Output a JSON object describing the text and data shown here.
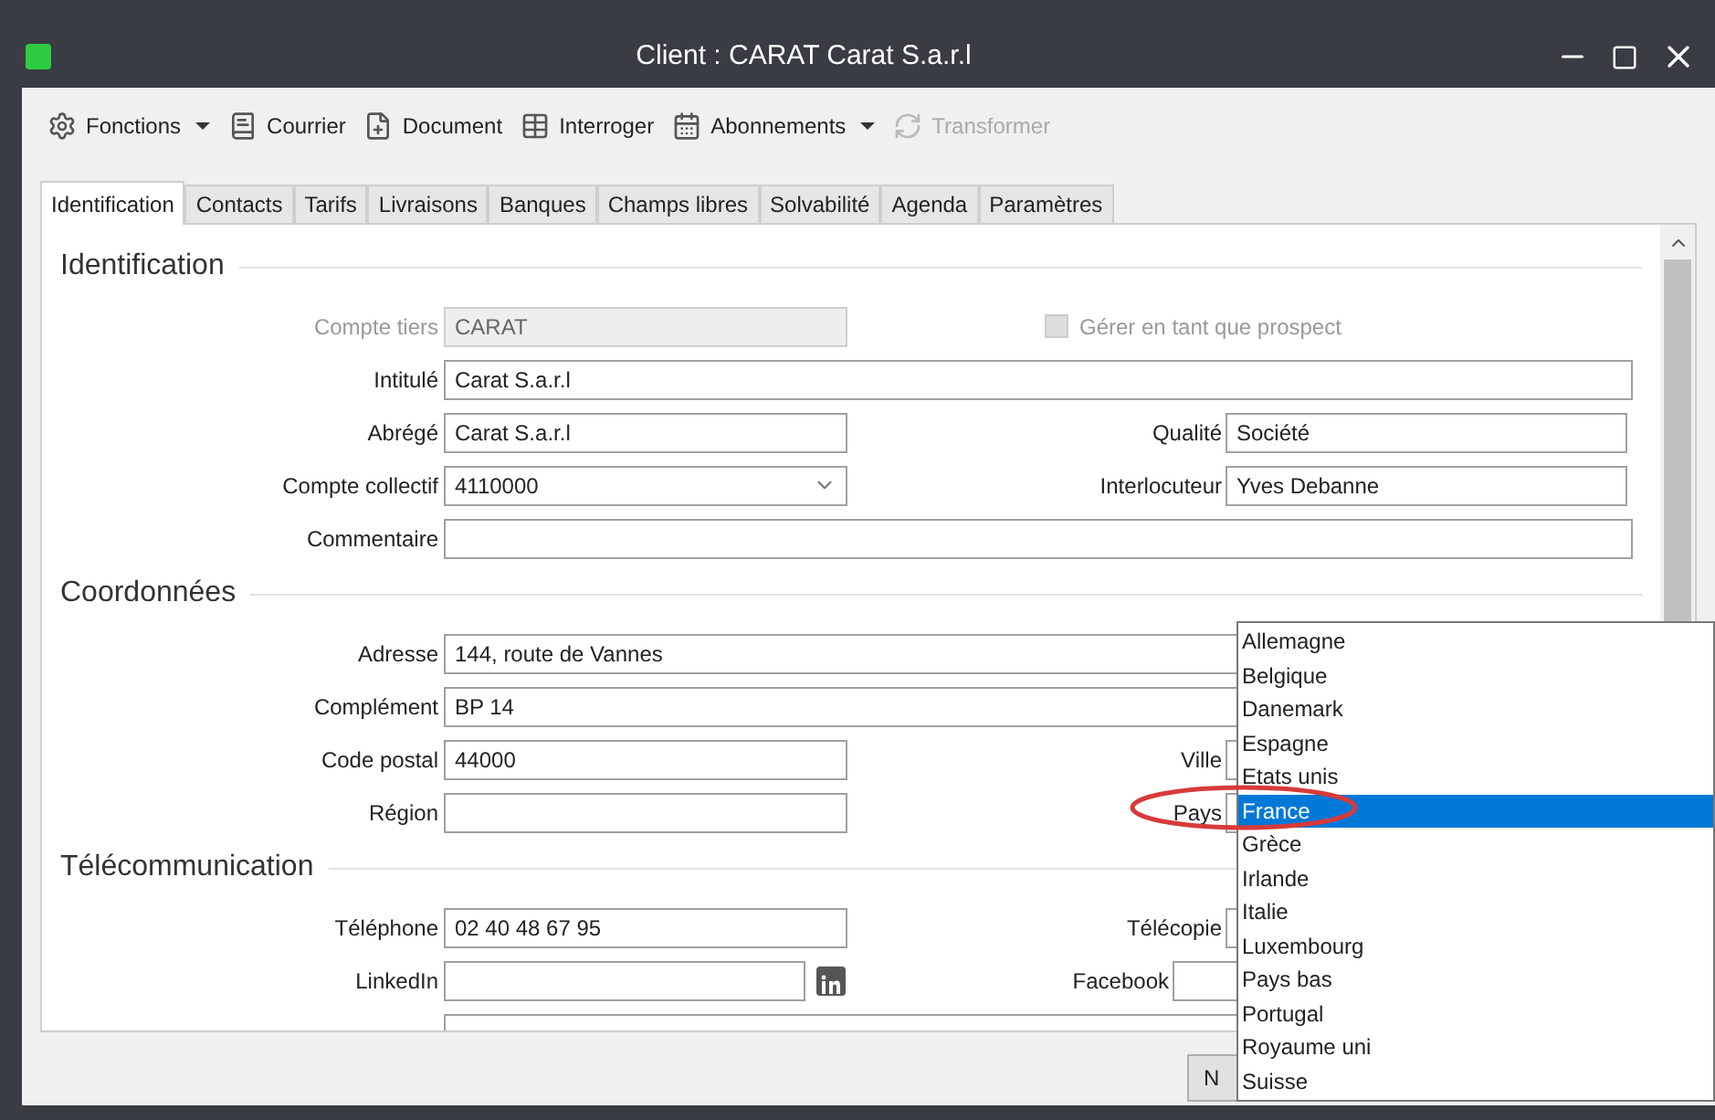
{
  "window": {
    "title": "Client : CARAT Carat S.a.r.l"
  },
  "toolbar": [
    {
      "kind": "gear",
      "label": "Fonctions",
      "dropdown": true,
      "disabled": false
    },
    {
      "kind": "book",
      "label": "Courrier",
      "dropdown": false,
      "disabled": false
    },
    {
      "kind": "doc",
      "label": "Document",
      "dropdown": false,
      "disabled": false
    },
    {
      "kind": "table",
      "label": "Interroger",
      "dropdown": false,
      "disabled": false
    },
    {
      "kind": "calendar",
      "label": "Abonnements",
      "dropdown": true,
      "disabled": false
    },
    {
      "kind": "transform",
      "label": "Transformer",
      "dropdown": false,
      "disabled": true
    }
  ],
  "tabs": [
    {
      "label": "Identification",
      "selected": true
    },
    {
      "label": "Contacts",
      "selected": false
    },
    {
      "label": "Tarifs",
      "selected": false
    },
    {
      "label": "Livraisons",
      "selected": false
    },
    {
      "label": "Banques",
      "selected": false
    },
    {
      "label": "Champs libres",
      "selected": false
    },
    {
      "label": "Solvabilité",
      "selected": false
    },
    {
      "label": "Agenda",
      "selected": false
    },
    {
      "label": "Paramètres",
      "selected": false
    }
  ],
  "sections": [
    {
      "title": "Identification",
      "rows": [
        {
          "left": {
            "label": "Compte tiers",
            "value": "CARAT",
            "kind": "text",
            "wide": false,
            "disabled": true
          },
          "right": {
            "kind": "checkbox",
            "label": "Gérer en tant que prospect",
            "checked": false,
            "disabled": true
          }
        },
        {
          "left": {
            "label": "Intitulé",
            "value": "Carat S.a.r.l",
            "kind": "text",
            "wide": true,
            "disabled": false
          }
        },
        {
          "left": {
            "label": "Abrégé",
            "value": "Carat S.a.r.l",
            "kind": "text",
            "wide": false,
            "disabled": false
          },
          "right": {
            "kind": "text",
            "label": "Qualité",
            "value": "Société"
          }
        },
        {
          "left": {
            "label": "Compte collectif",
            "value": "4110000",
            "kind": "combo",
            "wide": false,
            "disabled": false
          },
          "right": {
            "kind": "text",
            "label": "Interlocuteur",
            "value": "Yves Debanne"
          }
        },
        {
          "left": {
            "label": "Commentaire",
            "kind": "text",
            "wide": true,
            "disabled": false
          }
        }
      ]
    },
    {
      "title": "Coordonnées",
      "rows": [
        {
          "left": {
            "label": "Adresse",
            "value": "144, route de Vannes",
            "kind": "text",
            "wide": true,
            "disabled": false
          }
        },
        {
          "left": {
            "label": "Complément",
            "value": "BP 14",
            "kind": "text",
            "wide": true,
            "disabled": false
          }
        },
        {
          "left": {
            "label": "Code postal",
            "value": "44000",
            "kind": "text",
            "wide": false,
            "disabled": false
          },
          "right": {
            "kind": "text",
            "label": "Ville"
          }
        },
        {
          "left": {
            "label": "Région",
            "kind": "text",
            "wide": false,
            "disabled": false
          },
          "right": {
            "kind": "text",
            "label": "Pays"
          }
        }
      ]
    },
    {
      "title": "Télécommunication",
      "rows": [
        {
          "left": {
            "label": "Téléphone",
            "value": "02 40 48 67 95",
            "kind": "text",
            "wide": false,
            "disabled": false
          },
          "right": {
            "kind": "text",
            "label": "Télécopie"
          }
        },
        {
          "left": {
            "label": "LinkedIn",
            "kind": "linkedin",
            "wide": false,
            "disabled": false
          },
          "right": {
            "kind": "text",
            "label": "Facebook"
          }
        },
        {
          "left": {
            "kind": "text",
            "wide": true,
            "disabled": false
          }
        }
      ]
    }
  ],
  "footer_button": {
    "label": "N"
  },
  "country_list": [
    {
      "label": "Allemagne",
      "selected": false
    },
    {
      "label": "Belgique",
      "selected": false
    },
    {
      "label": "Danemark",
      "selected": false
    },
    {
      "label": "Espagne",
      "selected": false
    },
    {
      "label": "Etats unis",
      "selected": false
    },
    {
      "label": "France",
      "selected": true
    },
    {
      "label": "Grèce",
      "selected": false
    },
    {
      "label": "Irlande",
      "selected": false
    },
    {
      "label": "Italie",
      "selected": false
    },
    {
      "label": "Luxembourg",
      "selected": false
    },
    {
      "label": "Pays bas",
      "selected": false
    },
    {
      "label": "Portugal",
      "selected": false
    },
    {
      "label": "Royaume uni",
      "selected": false
    },
    {
      "label": "Suisse",
      "selected": false
    }
  ]
}
